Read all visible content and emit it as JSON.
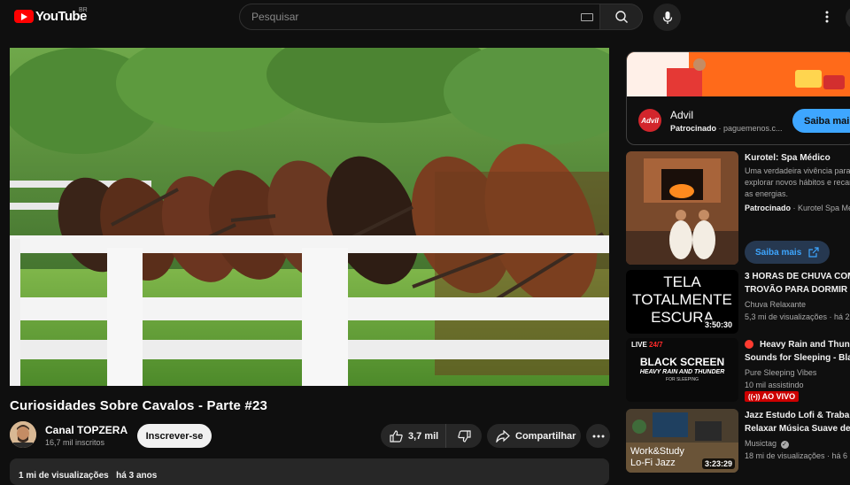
{
  "header": {
    "logo_text": "YouTube",
    "region": "BR",
    "search_placeholder": "Pesquisar"
  },
  "video": {
    "title": "Curiosidades Sobre Cavalos - Parte #23",
    "channel": "Canal TOPZERA",
    "subscribers": "16,7 mil inscritos",
    "subscribe_label": "Inscrever-se",
    "likes": "3,7 mil",
    "share_label": "Compartilhar",
    "views": "1 mi de visualizações",
    "age": "há 3 anos"
  },
  "ad": {
    "logo_text": "Advil",
    "title": "Advil",
    "sponsored": "Patrocinado",
    "domain": "paguemenos.c...",
    "cta": "Saiba mais"
  },
  "recommendations": [
    {
      "title": "Kurotel: Spa Médico",
      "description_1": "Uma verdadeira vivência para",
      "description_2": "explorar novos hábitos e recar",
      "description_3": "as energias.",
      "sponsored": "Patrocinado",
      "channel": "Kurotel Spa Mé",
      "cta": "Saiba mais"
    },
    {
      "title_1": "3 HORAS DE CHUVA COM",
      "title_2": "TROVÃO PARA DORMIR E",
      "channel": "Chuva Relaxante",
      "views": "5,3 mi de visualizações",
      "age": "há 2",
      "duration": "3:50:30",
      "thumb_text_1": "TELA",
      "thumb_text_2": "TOTALMENTE",
      "thumb_text_3": "ESCURA"
    },
    {
      "title_1": "Heavy Rain and Thund",
      "title_2": "Sounds for Sleeping - Bla",
      "channel": "Pure Sleeping Vibes",
      "watching": "10 mil assistindo",
      "live_label": "AO VIVO",
      "thumb_tag_1": "LIVE",
      "thumb_tag_2": "24/7",
      "thumb_text_1": "BLACK SCREEN",
      "thumb_text_2": "HEAVY RAIN AND THUNDER",
      "thumb_text_3": "FOR SLEEPING"
    },
    {
      "title_1": "Jazz Estudo Lofi & Trabal",
      "title_2": "Relaxar Música Suave de",
      "channel": "Musictag",
      "views": "18 mi de visualizações",
      "age": "há 6",
      "duration": "3:23:29",
      "thumb_text_1": "Work&Study",
      "thumb_text_2": "Lo-Fi Jazz"
    }
  ],
  "colors": {
    "background": "#0f0f0f",
    "accent_red": "#ff0000",
    "link_blue": "#3ea6ff",
    "live_red": "#cc0000"
  }
}
